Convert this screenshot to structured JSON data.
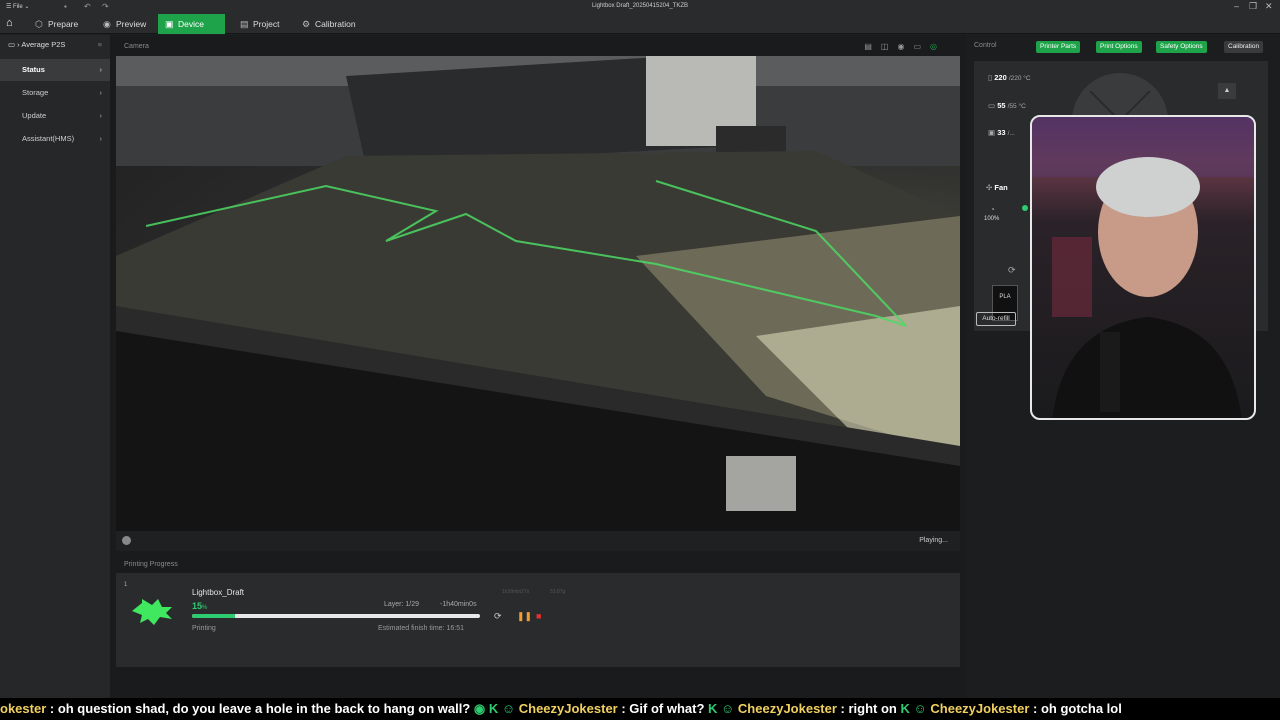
{
  "window": {
    "file_label": "File",
    "title": "Lightbox Draft_20250415204_TKZB"
  },
  "nav": {
    "tabs": [
      {
        "label": "Prepare"
      },
      {
        "label": "Preview"
      },
      {
        "label": "Device"
      },
      {
        "label": "Project"
      },
      {
        "label": "Calibration"
      }
    ],
    "active_tab": "Device"
  },
  "sidebar": {
    "printer_name": "Average P2S",
    "items": [
      {
        "label": "Status"
      },
      {
        "label": "Storage"
      },
      {
        "label": "Update"
      },
      {
        "label": "Assistant(HMS)"
      }
    ]
  },
  "camera": {
    "header": "Camera",
    "status": "Playing..."
  },
  "progress": {
    "header": "Printing Progress",
    "plate_number": "1",
    "job_name": "Lightbox_Draft",
    "percent_value": "15",
    "percent_unit": "%",
    "percent": 0.15,
    "layer": "Layer: 1/29",
    "remaining": "-1h40min0s",
    "meta_time": "1h39min27s",
    "meta_weight": "53.87g",
    "status": "Printing",
    "finish_time": "Estimated finish time: 16:51"
  },
  "control": {
    "header": "Control",
    "buttons": [
      {
        "label": "Printer Parts"
      },
      {
        "label": "Print Options"
      },
      {
        "label": "Safety Options"
      },
      {
        "label": "Calibration"
      }
    ],
    "nozzle_temp": "220",
    "nozzle_target": "/220 °C",
    "bed_temp": "55",
    "bed_target": "/55 °C",
    "chamber_temp": "33",
    "chamber_target": "/...",
    "fan_label": "Fan",
    "fan_percent": "100%",
    "filament": "PLA",
    "auto_refill": "Auto-refill"
  },
  "chat": {
    "messages": [
      {
        "user": "okester",
        "text": "oh question shad, do you leave a hole in the back to hang on wall?"
      },
      {
        "user": "CheezyJokester",
        "text": "Gif of what?"
      },
      {
        "user": "CheezyJokester",
        "text": "right on"
      },
      {
        "user": "CheezyJokester",
        "text": "oh gotcha lol"
      }
    ]
  },
  "colors": {
    "accent": "#1fa34a",
    "progress": "#2ecc71",
    "background": "#1e1f21"
  }
}
